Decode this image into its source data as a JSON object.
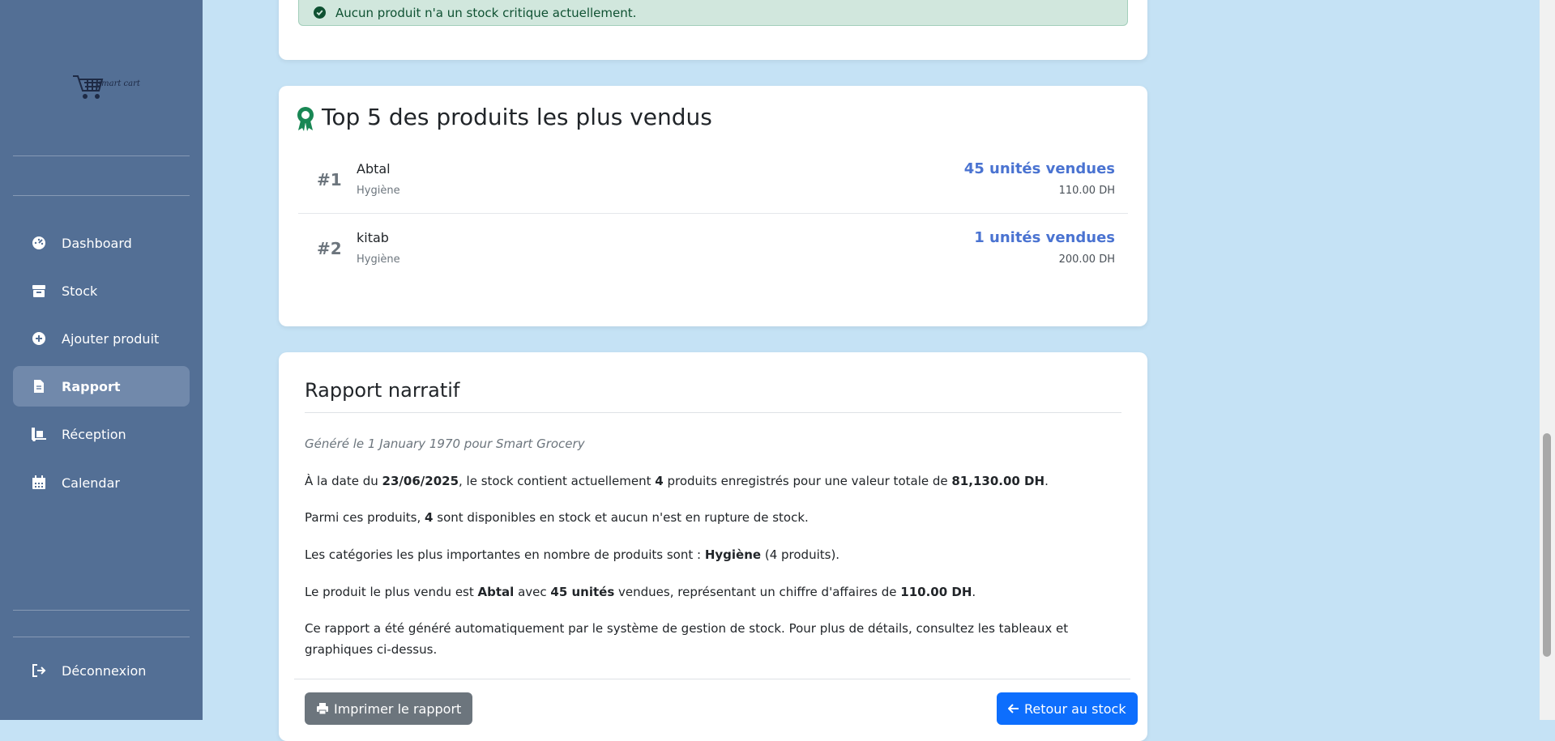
{
  "sidebar": {
    "logo_text": "smart cart",
    "items": [
      {
        "label": "Dashboard",
        "icon": "gauge-icon"
      },
      {
        "label": "Stock",
        "icon": "box-icon"
      },
      {
        "label": "Ajouter produit",
        "icon": "plus-circle-icon"
      },
      {
        "label": "Rapport",
        "icon": "file-icon",
        "active": true
      },
      {
        "label": "Réception",
        "icon": "truck-ramp-icon"
      },
      {
        "label": "Calendar",
        "icon": "calendar-icon"
      }
    ],
    "logout_label": "Déconnexion"
  },
  "alert": {
    "text": "Aucun produit n'a un stock critique actuellement."
  },
  "top_products": {
    "title": "Top 5 des produits les plus vendus",
    "rows": [
      {
        "rank": "#1",
        "name": "Abtal",
        "category": "Hygiène",
        "sold": "45 unités vendues",
        "price": "110.00 DH"
      },
      {
        "rank": "#2",
        "name": "kitab",
        "category": "Hygiène",
        "sold": "1 unités vendues",
        "price": "200.00 DH"
      }
    ]
  },
  "report": {
    "title": "Rapport narratif",
    "generated": "Généré le 1 January 1970 pour Smart Grocery",
    "p1": {
      "a": "À la date du ",
      "date": "23/06/2025",
      "b": ", le stock contient actuellement ",
      "count": "4",
      "c": " produits enregistrés pour une valeur totale de ",
      "value": "81,130.00 DH",
      "d": "."
    },
    "p2": {
      "a": "Parmi ces produits, ",
      "count": "4",
      "b": " sont disponibles en stock et aucun n'est en rupture de stock."
    },
    "p3": {
      "a": "Les catégories les plus importantes en nombre de produits sont : ",
      "cat": "Hygiène",
      "b": " (4 produits)."
    },
    "p4": {
      "a": "Le produit le plus vendu est ",
      "product": "Abtal",
      "b": " avec ",
      "units": "45 unités",
      "c": " vendues, représentant un chiffre d'affaires de ",
      "revenue": "110.00 DH",
      "d": "."
    },
    "p5": "Ce rapport a été généré automatiquement par le système de gestion de stock. Pour plus de détails, consultez les tableaux et graphiques ci-dessus.",
    "print_label": "Imprimer le rapport",
    "back_label": "Retour au stock"
  },
  "colors": {
    "sidebar": "#536f95",
    "accent": "#4a73d1",
    "primary": "#0d6efd",
    "success_bg": "#d1e7dd"
  }
}
